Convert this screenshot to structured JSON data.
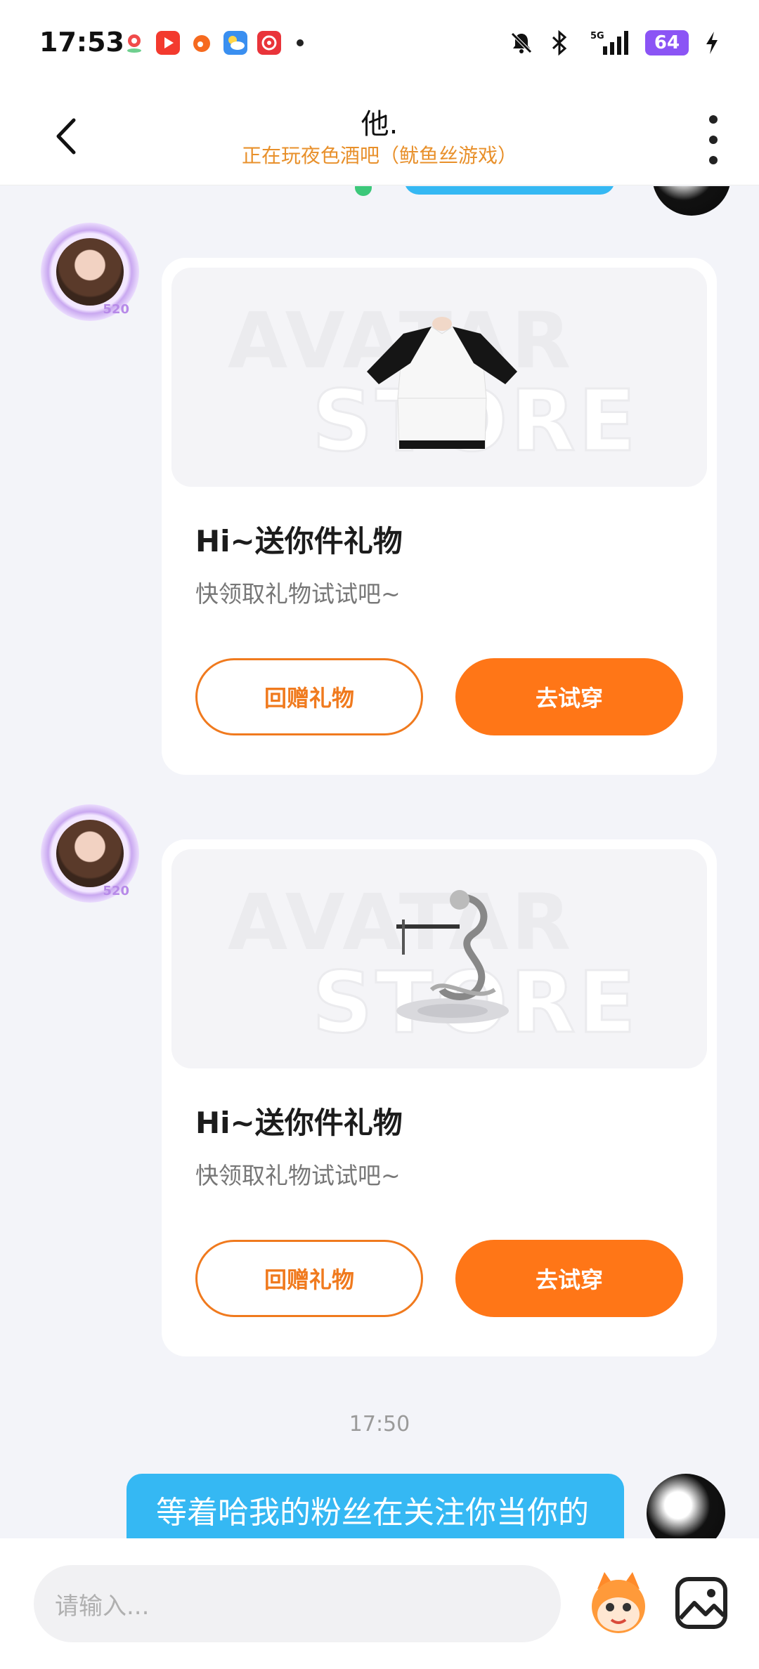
{
  "status_bar": {
    "time": "17:53",
    "battery": "64",
    "network": "5G",
    "icons": [
      "mute-bell-icon",
      "bluetooth-icon",
      "signal-icon",
      "charging-icon"
    ],
    "app_icons": [
      "maps-icon",
      "video-app-icon",
      "weibo-icon",
      "weather-icon",
      "music-app-icon"
    ]
  },
  "header": {
    "title": "他.",
    "subtitle": "正在玩夜色酒吧（鱿鱼丝游戏）",
    "back_icon": "back-chevron-icon",
    "more_icon": "more-vertical-icon"
  },
  "messages": [
    {
      "type": "gift_card",
      "watermark": [
        "AVATAR",
        "STORE"
      ],
      "item": "t-shirt",
      "title": "Hi~送你件礼物",
      "subtitle": "快领取礼物试试吧~",
      "secondary_button": "回赠礼物",
      "primary_button": "去试穿"
    },
    {
      "type": "gift_card",
      "watermark": [
        "AVATAR",
        "STORE"
      ],
      "item": "dragon-effect",
      "title": "Hi~送你件礼物",
      "subtitle": "快领取礼物试试吧~",
      "secondary_button": "回赠礼物",
      "primary_button": "去试穿"
    }
  ],
  "timestamp": "17:50",
  "my_message": "等着哈我的粉丝在关注你当你的粉丝呀",
  "avatar_badge": "520",
  "input": {
    "placeholder": "请输入..."
  },
  "colors": {
    "accent": "#ff7617",
    "bubble": "#35b8f3",
    "subtitle": "#e8902b"
  }
}
